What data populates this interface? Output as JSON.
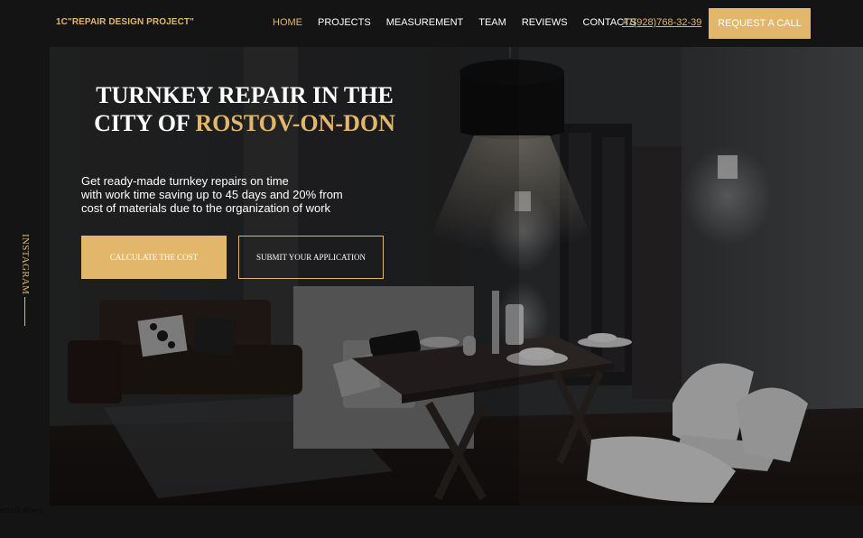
{
  "header": {
    "logo": "1C\"REPAIR DESIGN PROJECT\"",
    "nav": [
      {
        "label": "HOME",
        "active": true
      },
      {
        "label": "PROJECTS",
        "active": false
      },
      {
        "label": "MEASUREMENT",
        "active": false
      },
      {
        "label": "TEAM",
        "active": false
      },
      {
        "label": "REVIEWS",
        "active": false
      },
      {
        "label": "CONTACTS",
        "active": false
      }
    ],
    "phone": "+7(928)768-32-39",
    "request_button": "REQUEST A CALL"
  },
  "sidebar": {
    "social_link": "INSTAGRAM"
  },
  "hero": {
    "title_prefix": "TURNKEY REPAIR IN THE CITY OF",
    "title_accent": "ROSTOV-ON-DON",
    "subtitle_lines": [
      "Get ready-made turnkey repairs on time",
      "with work time saving up to 45 days and 20% from",
      "cost of materials due to the organization of work"
    ],
    "calc_button": "CALCULATE THE COST",
    "submit_button": "SUBMIT YOUR APPLICATION"
  },
  "footer": {
    "scroll_down": "scroll down"
  },
  "colors": {
    "accent": "#e2b76b",
    "background": "#141414",
    "text": "#ffffff"
  }
}
